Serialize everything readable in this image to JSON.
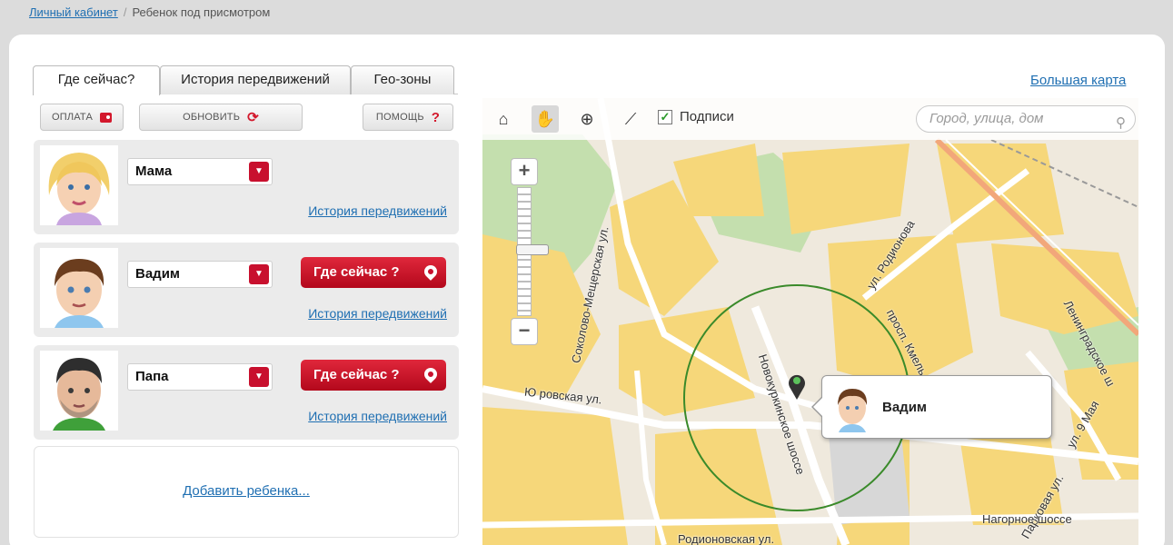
{
  "breadcrumb": {
    "home": "Личный кабинет",
    "sep": "/",
    "current": "Ребенок под присмотром"
  },
  "tabs": [
    {
      "label": "Где сейчас?",
      "active": true
    },
    {
      "label": "История передвижений",
      "active": false
    },
    {
      "label": "Гео-зоны",
      "active": false
    }
  ],
  "actions": {
    "pay": "ОПЛАТА",
    "refresh": "ОБНОВИТЬ",
    "help": "ПОМОЩЬ",
    "help_icon": "?"
  },
  "people": [
    {
      "name": "Мама",
      "where_button": "",
      "history_link": "История передвижений"
    },
    {
      "name": "Вадим",
      "where_button": "Где сейчас ?",
      "history_link": "История передвижений"
    },
    {
      "name": "Папа",
      "where_button": "Где сейчас ?",
      "history_link": "История передвижений"
    }
  ],
  "add_child": "Добавить ребенка...",
  "big_map": "Большая карта",
  "map": {
    "labels_toggle": "Подписи",
    "labels_checked": true,
    "search_placeholder": "Город, улица, дом",
    "popup_name": "Вадим",
    "streets": {
      "s1": "Ю ровская ул.",
      "s2": "Соколово-Мещерская ул.",
      "s3": "Новокуркинское шоссе",
      "s4": "ул. Родионова",
      "s5": "просп. Кмель",
      "s6": "Ленинградское ш",
      "s7": "ул. 9 Мая",
      "s8": "Парковая ул.",
      "s9": "Нагорное шоссе",
      "s10": "Родионовская ул."
    }
  },
  "colors": {
    "accent_red": "#c8102e",
    "link_blue": "#1f6fb2",
    "building_yellow": "#f6d77a",
    "park_green": "#b9dca0"
  }
}
